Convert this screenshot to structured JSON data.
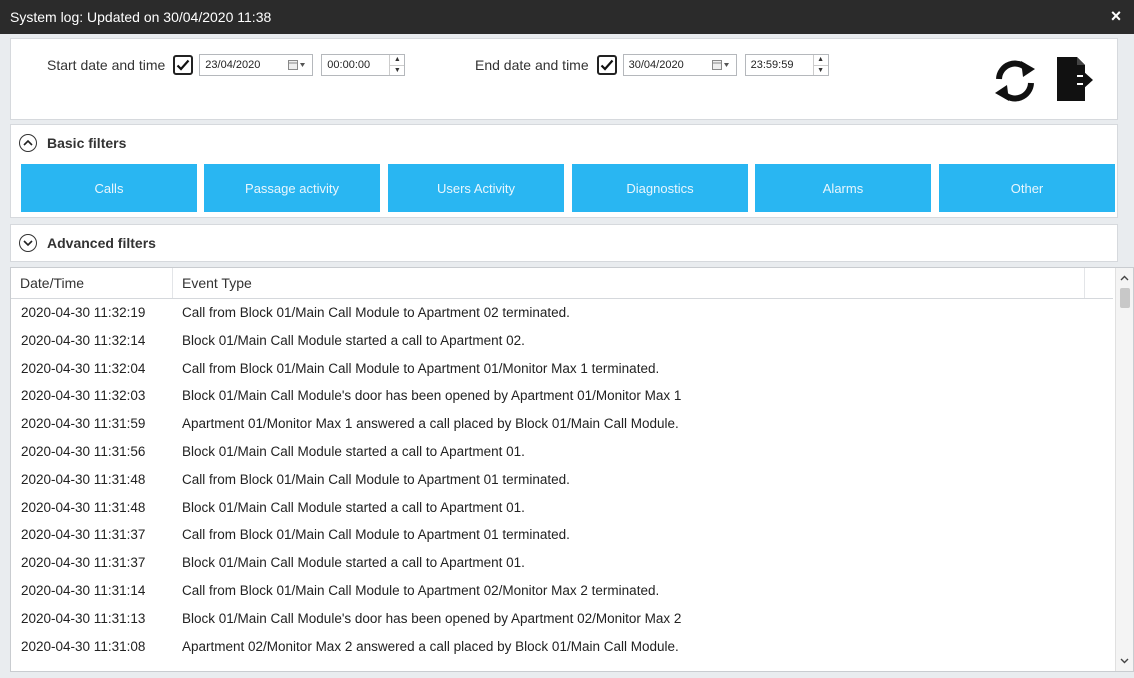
{
  "window": {
    "title": "System log: Updated on 30/04/2020 11:38",
    "close_label": "×"
  },
  "dates": {
    "start": {
      "label": "Start date and time",
      "checked": true,
      "date": "23/04/2020",
      "time": "00:00:00"
    },
    "end": {
      "label": "End date and time",
      "checked": true,
      "date": "30/04/2020",
      "time": "23:59:59"
    }
  },
  "icons": {
    "refresh": "refresh-icon",
    "export": "export-icon",
    "calendar": "calendar-icon"
  },
  "basic_filters": {
    "title": "Basic filters",
    "expanded": true,
    "buttons": [
      "Calls",
      "Passage activity",
      "Users Activity",
      "Diagnostics",
      "Alarms",
      "Other"
    ]
  },
  "advanced_filters": {
    "title": "Advanced filters",
    "expanded": false
  },
  "colors": {
    "filter_button": "#29b6f2",
    "titlebar": "#2b2b2b"
  },
  "table": {
    "columns": [
      "Date/Time",
      "Event Type"
    ],
    "rows": [
      {
        "datetime": "2020-04-30 11:32:19",
        "event": "Call from Block 01/Main Call Module to Apartment 02 terminated."
      },
      {
        "datetime": "2020-04-30 11:32:14",
        "event": "Block 01/Main Call Module started a call to Apartment 02."
      },
      {
        "datetime": "2020-04-30 11:32:04",
        "event": "Call from Block 01/Main Call Module to Apartment 01/Monitor Max 1 terminated."
      },
      {
        "datetime": "2020-04-30 11:32:03",
        "event": "Block 01/Main Call Module's door has been opened by Apartment 01/Monitor Max 1"
      },
      {
        "datetime": "2020-04-30 11:31:59",
        "event": "Apartment 01/Monitor Max 1 answered a call placed by Block 01/Main Call Module."
      },
      {
        "datetime": "2020-04-30 11:31:56",
        "event": "Block 01/Main Call Module started a call to Apartment 01."
      },
      {
        "datetime": "2020-04-30 11:31:48",
        "event": "Call from Block 01/Main Call Module to Apartment 01 terminated."
      },
      {
        "datetime": "2020-04-30 11:31:48",
        "event": "Block 01/Main Call Module started a call to Apartment 01."
      },
      {
        "datetime": "2020-04-30 11:31:37",
        "event": "Call from Block 01/Main Call Module to Apartment 01 terminated."
      },
      {
        "datetime": "2020-04-30 11:31:37",
        "event": "Block 01/Main Call Module started a call to Apartment 01."
      },
      {
        "datetime": "2020-04-30 11:31:14",
        "event": "Call from Block 01/Main Call Module to Apartment 02/Monitor Max 2 terminated."
      },
      {
        "datetime": "2020-04-30 11:31:13",
        "event": "Block 01/Main Call Module's door has been opened by Apartment 02/Monitor Max 2"
      },
      {
        "datetime": "2020-04-30 11:31:08",
        "event": "Apartment 02/Monitor Max 2 answered a call placed by Block 01/Main Call Module."
      }
    ]
  }
}
